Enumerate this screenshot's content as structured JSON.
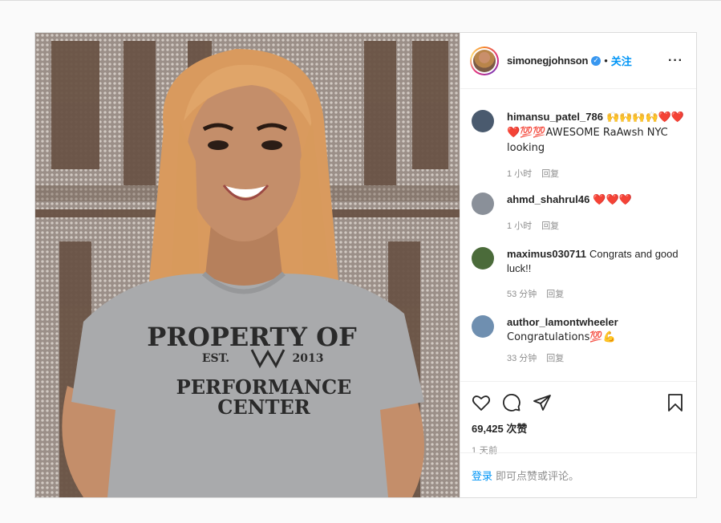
{
  "header": {
    "username": "simonegjohnson",
    "verified_mark": "✓",
    "separator": "•",
    "follow_label": "关注",
    "more_label": "···"
  },
  "comments": [
    {
      "user": "himansu_patel_786",
      "text": "🙌🙌🙌🙌❤️❤️❤️💯💯AWESOME RaAwsh NYC looking",
      "time": "1 小时",
      "reply": "回复",
      "avatar_color": "#4a5a6e"
    },
    {
      "user": "ahmd_shahrul46",
      "text": "❤️❤️❤️",
      "time": "1 小时",
      "reply": "回复",
      "avatar_color": "#8a9099"
    },
    {
      "user": "maximus030711",
      "text": "Congrats and good luck!!",
      "time": "53 分钟",
      "reply": "回复",
      "avatar_color": "#4b6b3a"
    },
    {
      "user": "author_lamontwheeler",
      "text": "Congratulations💯💪",
      "time": "33 分钟",
      "reply": "回复",
      "avatar_color": "#6f8fb0"
    }
  ],
  "stats": {
    "likes": "69,425 次赞",
    "posted": "1 天前"
  },
  "footer": {
    "login_label": "登录",
    "prompt": "即可点赞或评论。"
  },
  "image": {
    "shirt_line1": "PROPERTY OF",
    "shirt_est": "EST.",
    "shirt_year": "2013",
    "shirt_line2": "PERFORMANCE",
    "shirt_line3": "CENTER"
  }
}
